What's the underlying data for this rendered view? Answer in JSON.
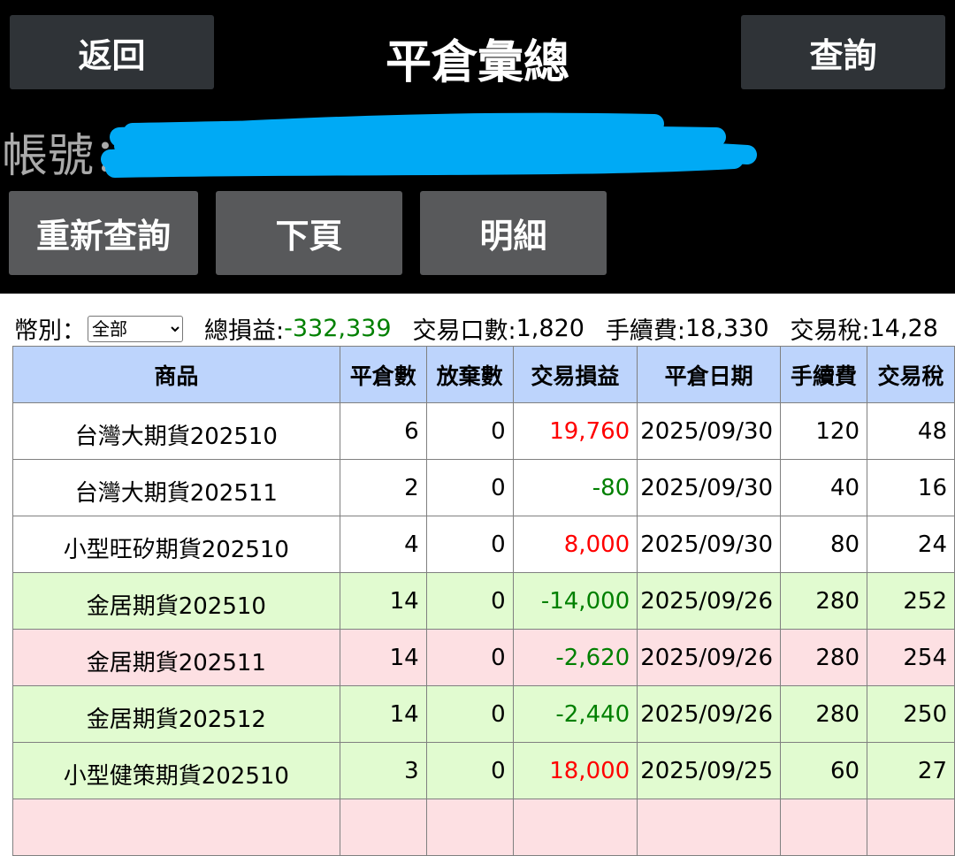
{
  "header": {
    "back_label": "返回",
    "title": "平倉彙總",
    "query_label": "查詢"
  },
  "account": {
    "label": "帳號："
  },
  "actions": {
    "requery_label": "重新查詢",
    "next_page_label": "下頁",
    "detail_label": "明細"
  },
  "summary": {
    "currency_label": "幣別：",
    "currency_value": "全部",
    "total_pl_label": "總損益:",
    "total_pl_value": "-332,339",
    "lots_label": "交易口數:",
    "lots_value": "1,820",
    "fee_label": "手續費:",
    "fee_value": "18,330",
    "tax_label": "交易稅:",
    "tax_value": "14,28"
  },
  "table": {
    "headers": [
      "商品",
      "平倉數",
      "放棄數",
      "交易損益",
      "平倉日期",
      "手續費",
      "交易稅"
    ],
    "rows": [
      {
        "product": "台灣大期貨202510",
        "closed": "6",
        "abandoned": "0",
        "pl": "19,760",
        "pl_color": "red",
        "date": "2025/09/30",
        "fee": "120",
        "tax": "48",
        "bg": "white"
      },
      {
        "product": "台灣大期貨202511",
        "closed": "2",
        "abandoned": "0",
        "pl": "-80",
        "pl_color": "green",
        "date": "2025/09/30",
        "fee": "40",
        "tax": "16",
        "bg": "white"
      },
      {
        "product": "小型旺矽期貨202510",
        "closed": "4",
        "abandoned": "0",
        "pl": "8,000",
        "pl_color": "red",
        "date": "2025/09/30",
        "fee": "80",
        "tax": "24",
        "bg": "white"
      },
      {
        "product": "金居期貨202510",
        "closed": "14",
        "abandoned": "0",
        "pl": "-14,000",
        "pl_color": "green",
        "date": "2025/09/26",
        "fee": "280",
        "tax": "252",
        "bg": "green"
      },
      {
        "product": "金居期貨202511",
        "closed": "14",
        "abandoned": "0",
        "pl": "-2,620",
        "pl_color": "green",
        "date": "2025/09/26",
        "fee": "280",
        "tax": "254",
        "bg": "pink"
      },
      {
        "product": "金居期貨202512",
        "closed": "14",
        "abandoned": "0",
        "pl": "-2,440",
        "pl_color": "green",
        "date": "2025/09/26",
        "fee": "280",
        "tax": "250",
        "bg": "green"
      },
      {
        "product": "小型健策期貨202510",
        "closed": "3",
        "abandoned": "0",
        "pl": "18,000",
        "pl_color": "red",
        "date": "2025/09/25",
        "fee": "60",
        "tax": "27",
        "bg": "green"
      },
      {
        "product": "",
        "closed": "",
        "abandoned": "",
        "pl": "",
        "pl_color": "green",
        "date": "",
        "fee": "",
        "tax": "",
        "bg": "pink"
      }
    ]
  }
}
